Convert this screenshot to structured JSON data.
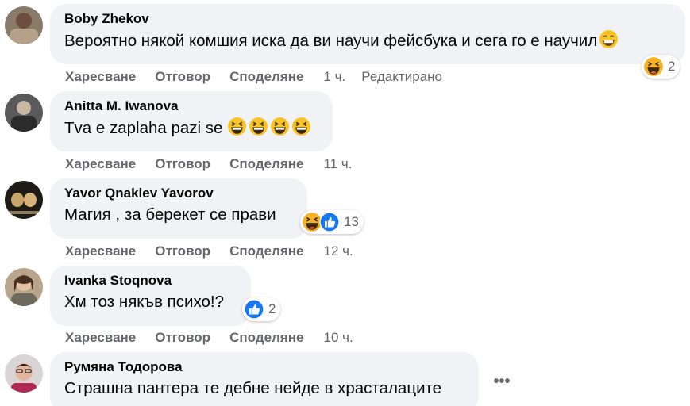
{
  "comments": [
    {
      "author": "Boby Zhekov",
      "text": "Вероятно някой комшия иска да ви научи фейсбука и сега го е научил",
      "actions": {
        "like": "Харесване",
        "reply": "Отговор",
        "share": "Споделяне"
      },
      "time": "1 ч.",
      "edited": "Редактирано",
      "reaction_count": "2",
      "reaction_icons": [
        "haha-icon"
      ]
    },
    {
      "author": "Anitta M. Iwanova",
      "text": "Tva e zaplaha pazi se",
      "actions": {
        "like": "Харесване",
        "reply": "Отговор",
        "share": "Споделяне"
      },
      "time": "11 ч."
    },
    {
      "author": "Yavor Qnakiev Yavorov",
      "text": "Магия , за берекет се прави",
      "actions": {
        "like": "Харесване",
        "reply": "Отговор",
        "share": "Споделяне"
      },
      "time": "12 ч.",
      "reaction_count": "13",
      "reaction_icons": [
        "haha-icon",
        "like-icon"
      ]
    },
    {
      "author": "Ivanka Stoqnova",
      "text": "Хм тоз някъв психо!?",
      "actions": {
        "like": "Харесване",
        "reply": "Отговор",
        "share": "Споделяне"
      },
      "time": "10 ч.",
      "reaction_count": "2",
      "reaction_icons": [
        "like-icon"
      ]
    },
    {
      "author": "Румяна Тодорова",
      "text": "Страшна пантера те дебне нейде в храсталаците"
    }
  ],
  "more_options_glyph": "•••",
  "colors": {
    "bubble": "#f0f2f5",
    "meta_text": "#65676b",
    "like_blue": "#1877f2",
    "haha_yellow": "#f7b125"
  }
}
